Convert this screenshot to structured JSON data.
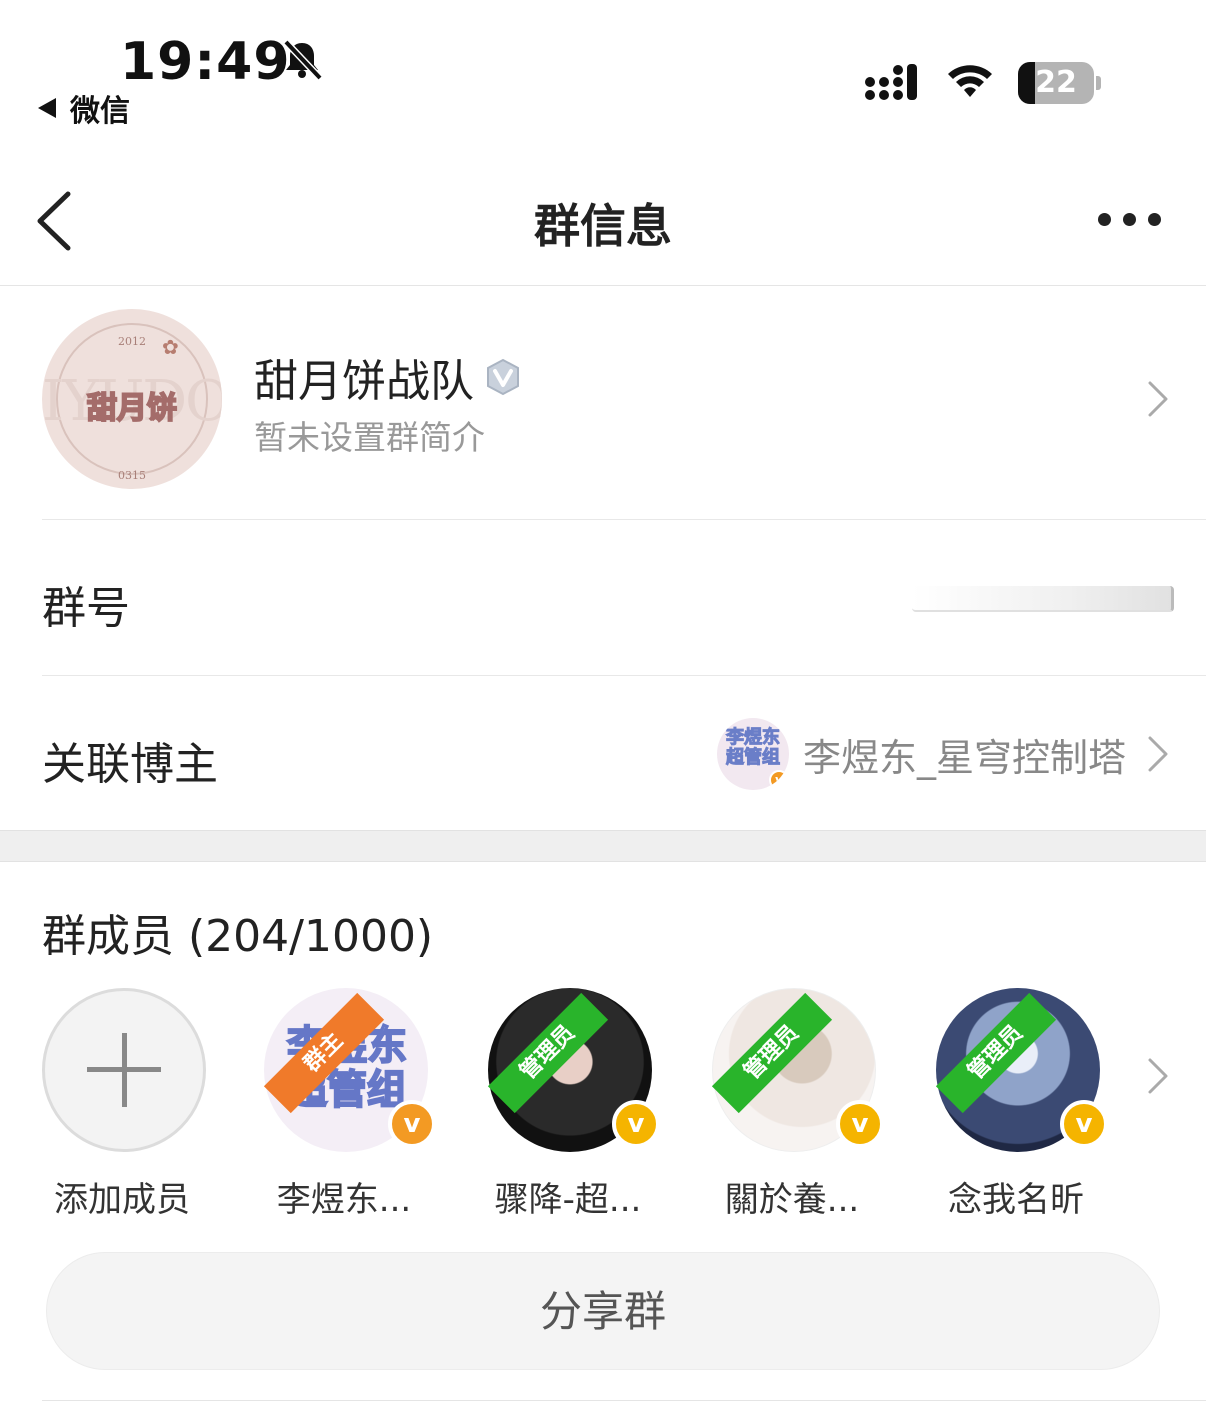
{
  "status_bar": {
    "time": "19:49",
    "back_app": "微信",
    "battery": 22
  },
  "nav": {
    "title": "群信息"
  },
  "group": {
    "name": "甜月饼战队",
    "description": "暂未设置群简介",
    "avatar_text": "甜月饼",
    "avatar_bg_text": "IYUDON",
    "avatar_year": "2012",
    "avatar_code": "0315"
  },
  "rows": {
    "group_id_label": "群号",
    "blogger_label": "关联博主",
    "blogger_name": "李煜东_星穹控制塔",
    "blogger_avatar_text": "李煜东超管组"
  },
  "members": {
    "title": "群成员 (204/1000)",
    "add_label": "添加成员",
    "list": [
      {
        "name": "李煜东...",
        "role": "群主",
        "avatar_text": "李煜东超管组"
      },
      {
        "name": "骤降-超...",
        "role": "管理员"
      },
      {
        "name": "關於養...",
        "role": "管理员"
      },
      {
        "name": "念我名昕",
        "role": "管理员"
      }
    ]
  },
  "share_button": "分享群",
  "colors": {
    "owner_ribbon": "#f07a2a",
    "admin_ribbon": "#29b42b",
    "verified_orange": "#f39a23",
    "verified_yellow": "#f5b400"
  }
}
